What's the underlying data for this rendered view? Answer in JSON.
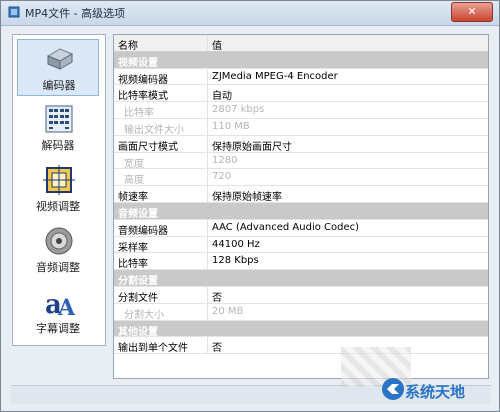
{
  "window": {
    "title": "MP4文件 - 高级选项",
    "close_label": "✕"
  },
  "sidebar": {
    "items": [
      {
        "label": "编码器",
        "icon": "encoder-icon",
        "active": true
      },
      {
        "label": "解码器",
        "icon": "decoder-icon",
        "active": false
      },
      {
        "label": "视频调整",
        "icon": "video-adjust-icon",
        "active": false
      },
      {
        "label": "音频调整",
        "icon": "audio-adjust-icon",
        "active": false
      },
      {
        "label": "字幕调整",
        "icon": "subtitle-adjust-icon",
        "active": false
      }
    ]
  },
  "grid": {
    "columns": [
      "名称",
      "值"
    ],
    "rows": [
      {
        "type": "group",
        "name": "视频设置",
        "value": ""
      },
      {
        "type": "item",
        "name": "视频编码器",
        "value": "ZJMedia MPEG-4 Encoder"
      },
      {
        "type": "item",
        "name": "比特率模式",
        "value": "自动"
      },
      {
        "type": "disabled",
        "name": "比特率",
        "value": "2807 kbps"
      },
      {
        "type": "disabled",
        "name": "输出文件大小",
        "value": "110 MB"
      },
      {
        "type": "item",
        "name": "画面尺寸模式",
        "value": "保持原始画面尺寸"
      },
      {
        "type": "disabled",
        "name": "宽度",
        "value": "1280"
      },
      {
        "type": "disabled",
        "name": "高度",
        "value": "720"
      },
      {
        "type": "item",
        "name": "帧速率",
        "value": "保持原始帧速率"
      },
      {
        "type": "group",
        "name": "音频设置",
        "value": ""
      },
      {
        "type": "item",
        "name": "音频编码器",
        "value": "AAC (Advanced Audio Codec)"
      },
      {
        "type": "item",
        "name": "采样率",
        "value": "44100 Hz"
      },
      {
        "type": "item",
        "name": "比特率",
        "value": "128 Kbps"
      },
      {
        "type": "group",
        "name": "分割设置",
        "value": ""
      },
      {
        "type": "item",
        "name": "分割文件",
        "value": "否"
      },
      {
        "type": "disabled",
        "name": "分割大小",
        "value": "20 MB"
      },
      {
        "type": "group",
        "name": "其他设置",
        "value": ""
      },
      {
        "type": "item",
        "name": "输出到单个文件",
        "value": "否"
      }
    ]
  },
  "watermark": {
    "text": "系统天地"
  },
  "colors": {
    "group_bg": "#c9c9c9",
    "active_item": "#dbe8f8",
    "watermark": "#2a74c8"
  }
}
